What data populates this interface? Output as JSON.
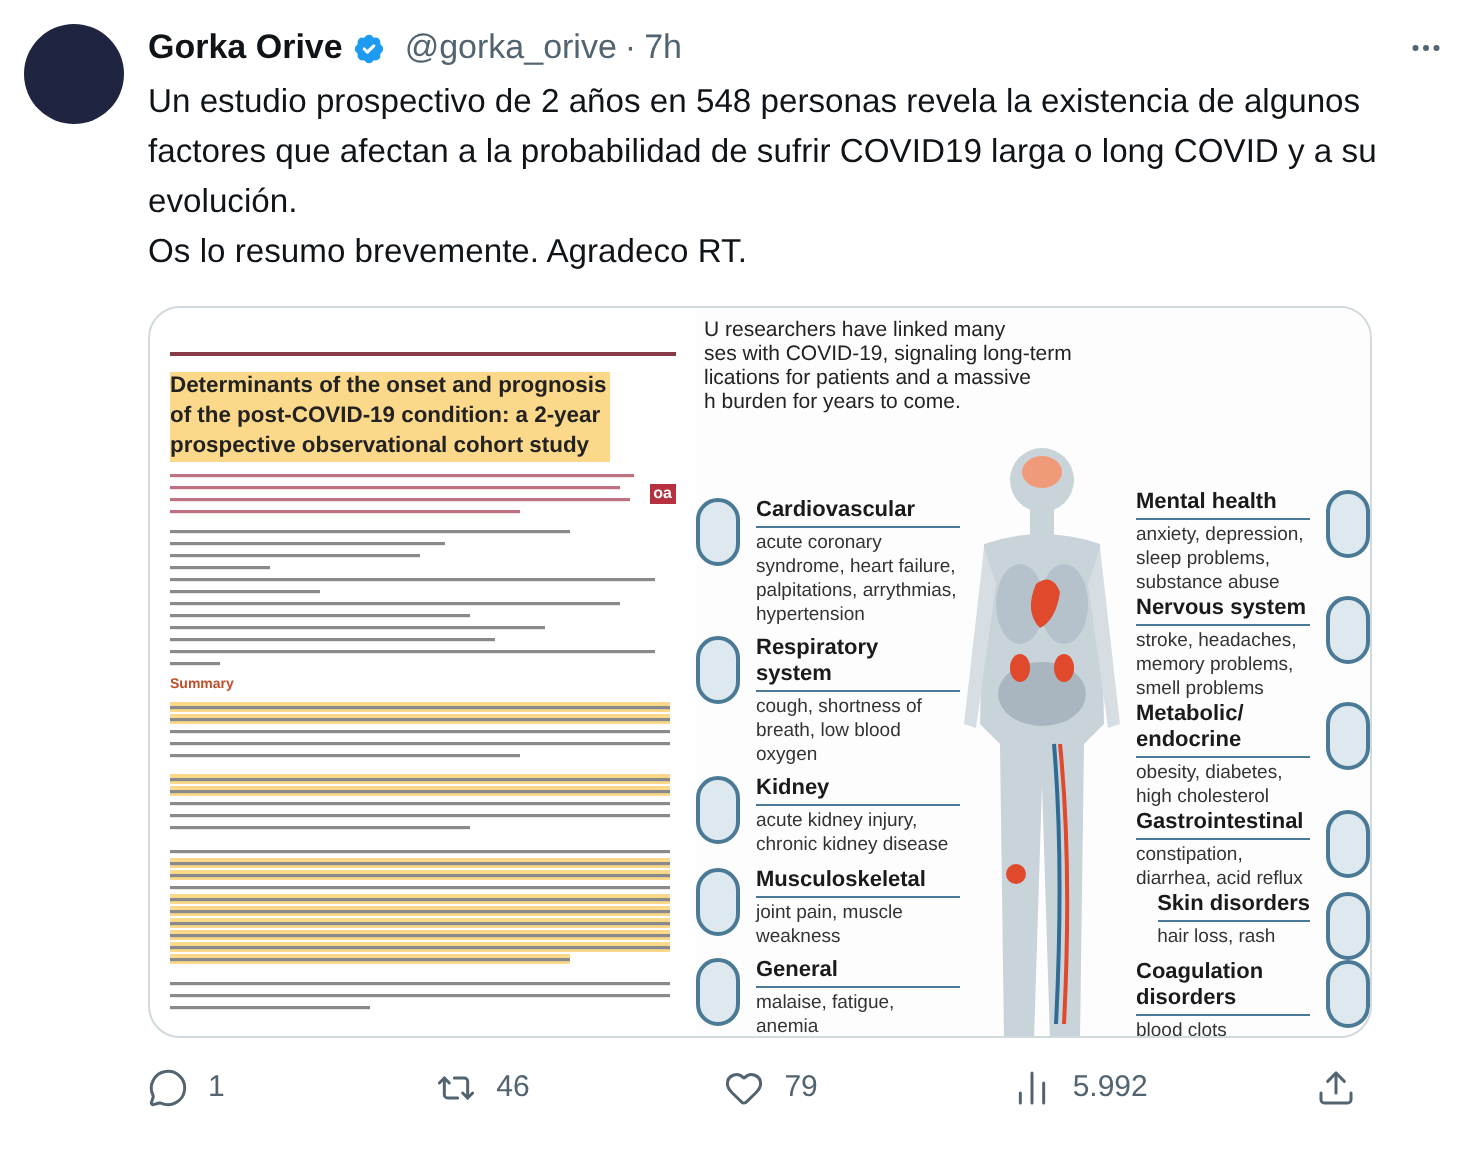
{
  "author": {
    "name": "Gorka Orive",
    "verified": true,
    "handle": "@gorka_orive",
    "separator": "·",
    "time": "7h"
  },
  "text": [
    "Un estudio prospectivo de 2 años en 548 personas revela la existencia de algunos factores que afectan a la probabilidad de sufrir COVID19 larga o long COVID y a su evolución.",
    "Os lo resumo brevemente. Agradeco RT."
  ],
  "media": {
    "paper": {
      "title": "Determinants of the onset and prognosis of the post-COVID-19 condition: a 2-year prospective observational cohort study",
      "badge": "oa",
      "section": "Summary"
    },
    "infographic": {
      "intro_lines": [
        "U researchers have linked many",
        "ses with COVID-19, signaling long-term",
        "lications for patients and a massive",
        "h burden for years to come."
      ],
      "left": [
        {
          "title": "Cardiovascular",
          "detail": "acute coronary syndrome, heart failure, palpitations, arrythmias, hypertension"
        },
        {
          "title": "Respiratory system",
          "detail": "cough, shortness of breath, low blood oxygen"
        },
        {
          "title": "Kidney",
          "detail": "acute kidney injury, chronic kidney disease"
        },
        {
          "title": "Musculoskeletal",
          "detail": "joint pain, muscle weakness"
        },
        {
          "title": "General",
          "detail": "malaise, fatigue, anemia"
        }
      ],
      "right": [
        {
          "title": "Mental health",
          "detail": "anxiety, depression, sleep problems, substance abuse"
        },
        {
          "title": "Nervous system",
          "detail": "stroke, headaches, memory problems, smell problems"
        },
        {
          "title": "Metabolic/ endocrine",
          "detail": "obesity, diabetes, high cholesterol"
        },
        {
          "title": "Gastrointestinal",
          "detail": "constipation, diarrhea, acid reflux"
        },
        {
          "title": "Skin disorders",
          "detail": "hair loss, rash"
        },
        {
          "title": "Coagulation disorders",
          "detail": "blood clots"
        }
      ]
    }
  },
  "actions": [
    {
      "kind": "reply",
      "count": "1"
    },
    {
      "kind": "repost",
      "count": "46"
    },
    {
      "kind": "like",
      "count": "79"
    },
    {
      "kind": "views",
      "count": "5.992"
    },
    {
      "kind": "share"
    }
  ]
}
